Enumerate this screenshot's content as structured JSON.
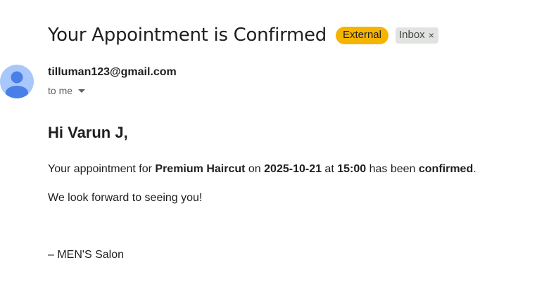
{
  "subject": {
    "title": "Your Appointment is Confirmed",
    "labels": {
      "external": "External",
      "inbox": "Inbox",
      "inbox_remove": "×"
    }
  },
  "sender": {
    "email": "tilluman123@gmail.com",
    "recipient": "to me",
    "avatar_icon": "person-icon"
  },
  "body": {
    "greeting": "Hi Varun J,",
    "line1": {
      "prefix": "Your appointment for ",
      "service": "Premium Haircut",
      "on": " on ",
      "date": "2025-10-21",
      "at": " at ",
      "time": "15:00",
      "has_been": " has been ",
      "status": "confirmed",
      "end": "."
    },
    "line2": "We look forward to seeing you!",
    "signature": "– MEN'S Salon"
  },
  "colors": {
    "external_label": "#f5b400",
    "inbox_label": "#e1e3e1",
    "avatar_bg": "#a8c7fa",
    "avatar_fg": "#4a7fe8"
  }
}
